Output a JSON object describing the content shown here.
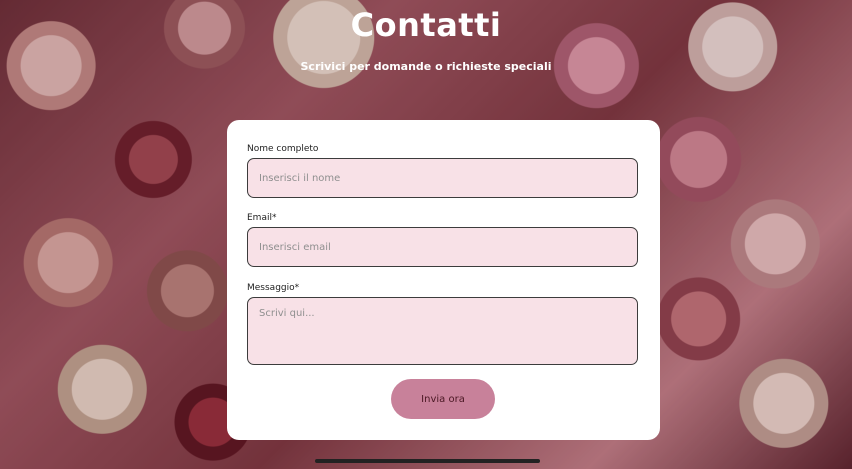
{
  "header": {
    "title": "Contatti",
    "subtitle": "Scrivici per domande o richieste speciali"
  },
  "form": {
    "name": {
      "label": "Nome completo",
      "placeholder": "Inserisci il nome",
      "value": ""
    },
    "email": {
      "label": "Email*",
      "placeholder": "Inserisci email",
      "value": ""
    },
    "message": {
      "label": "Messaggio*",
      "placeholder": "Scrivi qui...",
      "value": ""
    },
    "submit_label": "Invia ora"
  },
  "colors": {
    "accent": "#c8819a",
    "field_background": "#f8e1e7",
    "card_background": "#ffffff",
    "title_text": "#ffffff"
  }
}
